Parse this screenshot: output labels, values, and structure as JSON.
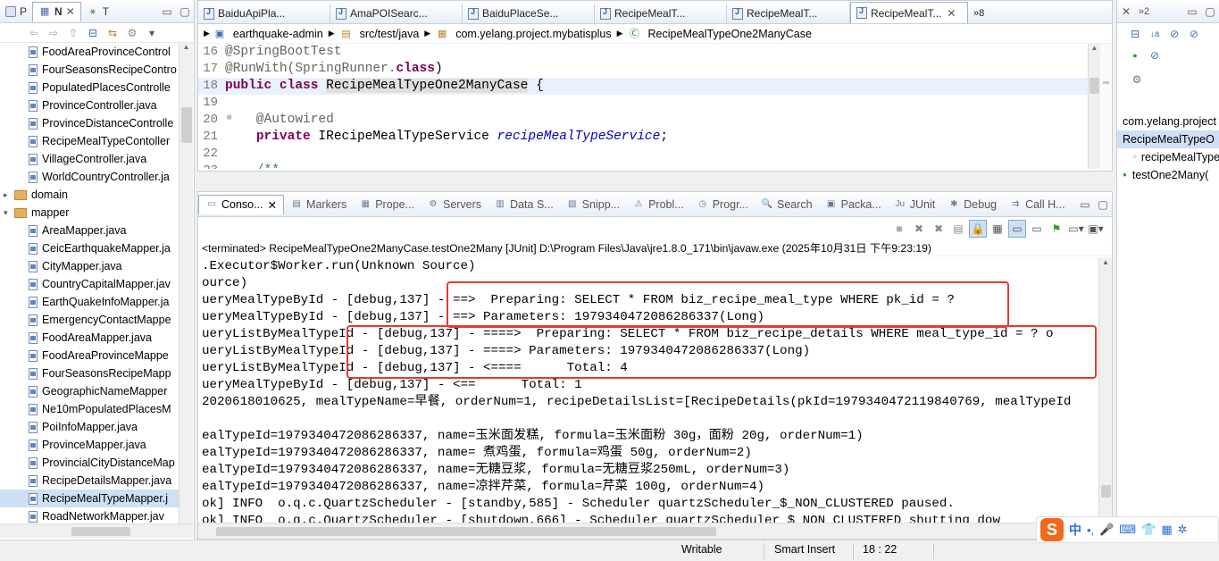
{
  "left_panel": {
    "view_tabs": [
      "P",
      "N",
      "T"
    ],
    "tree_items": [
      {
        "label": "FoodAreaProvinceControl",
        "type": "file",
        "indent": 2
      },
      {
        "label": "FourSeasonsRecipeContro",
        "type": "file",
        "indent": 2
      },
      {
        "label": "PopulatedPlacesControlle",
        "type": "file",
        "indent": 2
      },
      {
        "label": "ProvinceController.java",
        "type": "file",
        "indent": 2
      },
      {
        "label": "ProvinceDistanceControlle",
        "type": "file",
        "indent": 2
      },
      {
        "label": "RecipeMealTypeContoller",
        "type": "file",
        "indent": 2
      },
      {
        "label": "VillageController.java",
        "type": "file",
        "indent": 2
      },
      {
        "label": "WorldCountryController.ja",
        "type": "file",
        "indent": 2
      },
      {
        "label": "domain",
        "type": "package",
        "indent": 1
      },
      {
        "label": "mapper",
        "type": "package",
        "indent": 1
      },
      {
        "label": "AreaMapper.java",
        "type": "file",
        "indent": 2
      },
      {
        "label": "CeicEarthquakeMapper.ja",
        "type": "file",
        "indent": 2
      },
      {
        "label": "CityMapper.java",
        "type": "file",
        "indent": 2
      },
      {
        "label": "CountryCapitalMapper.jav",
        "type": "file",
        "indent": 2
      },
      {
        "label": "EarthQuakeInfoMapper.ja",
        "type": "file",
        "indent": 2
      },
      {
        "label": "EmergencyContactMappe",
        "type": "file",
        "indent": 2
      },
      {
        "label": "FoodAreaMapper.java",
        "type": "file",
        "indent": 2
      },
      {
        "label": "FoodAreaProvinceMappe",
        "type": "file",
        "indent": 2
      },
      {
        "label": "FourSeasonsRecipeMapp",
        "type": "file",
        "indent": 2
      },
      {
        "label": "GeographicNameMapper",
        "type": "file",
        "indent": 2
      },
      {
        "label": "Ne10mPopulatedPlacesM",
        "type": "file",
        "indent": 2
      },
      {
        "label": "PoiInfoMapper.java",
        "type": "file",
        "indent": 2
      },
      {
        "label": "ProvinceMapper.java",
        "type": "file",
        "indent": 2
      },
      {
        "label": "ProvincialCityDistanceMap",
        "type": "file",
        "indent": 2
      },
      {
        "label": "RecipeDetailsMapper.java",
        "type": "file",
        "indent": 2
      },
      {
        "label": "RecipeMealTypeMapper.j",
        "type": "file",
        "indent": 2,
        "selected": true
      },
      {
        "label": "RoadNetworkMapper.jav",
        "type": "file",
        "indent": 2
      }
    ]
  },
  "editor": {
    "tabs": [
      {
        "label": "BaiduApiPla..."
      },
      {
        "label": "AmaPOISearc..."
      },
      {
        "label": "BaiduPlaceSe..."
      },
      {
        "label": "RecipeMealT..."
      },
      {
        "label": "RecipeMealT..."
      },
      {
        "label": "RecipeMealT...",
        "active": true
      }
    ],
    "overflow_label": "»8",
    "breadcrumb": [
      "earthquake-admin",
      "src/test/java",
      "com.yelang.project.mybatisplus",
      "RecipeMealTypeOne2ManyCase"
    ],
    "code_lines": [
      {
        "num": "16",
        "text": "@SpringBootTest"
      },
      {
        "num": "17",
        "text": "@RunWith(SpringRunner.class)"
      },
      {
        "num": "18",
        "text": "public class RecipeMealTypeOne2ManyCase {"
      },
      {
        "num": "19",
        "text": ""
      },
      {
        "num": "20",
        "text": "    @Autowired"
      },
      {
        "num": "21",
        "text": "    private IRecipeMealTypeService recipeMealTypeService;"
      },
      {
        "num": "22",
        "text": ""
      },
      {
        "num": "23",
        "text": "    /**"
      }
    ]
  },
  "console": {
    "tabs": [
      "Conso...",
      "Markers",
      "Prope...",
      "Servers",
      "Data S...",
      "Snipp...",
      "Probl...",
      "Progr...",
      "Search",
      "Packa...",
      "JUnit",
      "Debug",
      "Call H..."
    ],
    "terminated_text": "<terminated> RecipeMealTypeOne2ManyCase.testOne2Many [JUnit] D:\\Program Files\\Java\\jre1.8.0_171\\bin\\javaw.exe (2025年10月31日 下午9:23:19)",
    "lines": [
      ".Executor$Worker.run(Unknown Source)",
      "ource)",
      "ueryMealTypeById - [debug,137] - ==>  Preparing: SELECT * FROM biz_recipe_meal_type WHERE pk_id = ?",
      "ueryMealTypeById - [debug,137] - ==> Parameters: 1979340472086286337(Long)",
      "ueryListByMealTypeId - [debug,137] - ====>  Preparing: SELECT * FROM biz_recipe_details WHERE meal_type_id = ? o",
      "ueryListByMealTypeId - [debug,137] - ====> Parameters: 1979340472086286337(Long)",
      "ueryListByMealTypeId - [debug,137] - <====      Total: 4",
      "ueryMealTypeById - [debug,137] - <==      Total: 1",
      "2020618010625, mealTypeName=早餐, orderNum=1, recipeDetailsList=[RecipeDetails(pkId=1979340472119840769, mealTypeId",
      "",
      "ealTypeId=1979340472086286337, name=玉米面发糕, formula=玉米面粉 30g，面粉 20g, orderNum=1)",
      "ealTypeId=1979340472086286337, name= 煮鸡蛋, formula=鸡蛋 50g, orderNum=2)",
      "ealTypeId=1979340472086286337, name=无糖豆浆, formula=无糖豆浆250mL, orderNum=3)",
      "ealTypeId=1979340472086286337, name=凉拌芹菜, formula=芹菜 100g, orderNum=4)",
      "ok] INFO  o.q.c.QuartzScheduler - [standby,585] - Scheduler quartzScheduler_$_NON_CLUSTERED paused.",
      "ok] INFO  o.q.c.QuartzScheduler - [shutdown,666] - Scheduler quartzScheduler_$_NON_CLUSTERED shutting dow"
    ]
  },
  "outline": {
    "items": [
      {
        "label": "com.yelang.project"
      },
      {
        "label": "RecipeMealTypeO",
        "selected": true
      },
      {
        "label": "recipeMealType"
      },
      {
        "label": "testOne2Many("
      }
    ]
  },
  "status_bar": {
    "writable": "Writable",
    "insert_mode": "Smart Insert",
    "position": "18 : 22"
  },
  "ime_bar": {
    "logo": "S",
    "lang": "中",
    "items": [
      "•,",
      "mic",
      "keyboard",
      "shirt",
      "apps",
      "settings"
    ]
  },
  "colors": {
    "highlight_box": "#e53935",
    "selection": "#cde0f5",
    "keyword": "#7f0055",
    "annotation": "#646464",
    "field": "#0000c0",
    "comment": "#3f7f5f",
    "ime_orange": "#f06a1d"
  }
}
